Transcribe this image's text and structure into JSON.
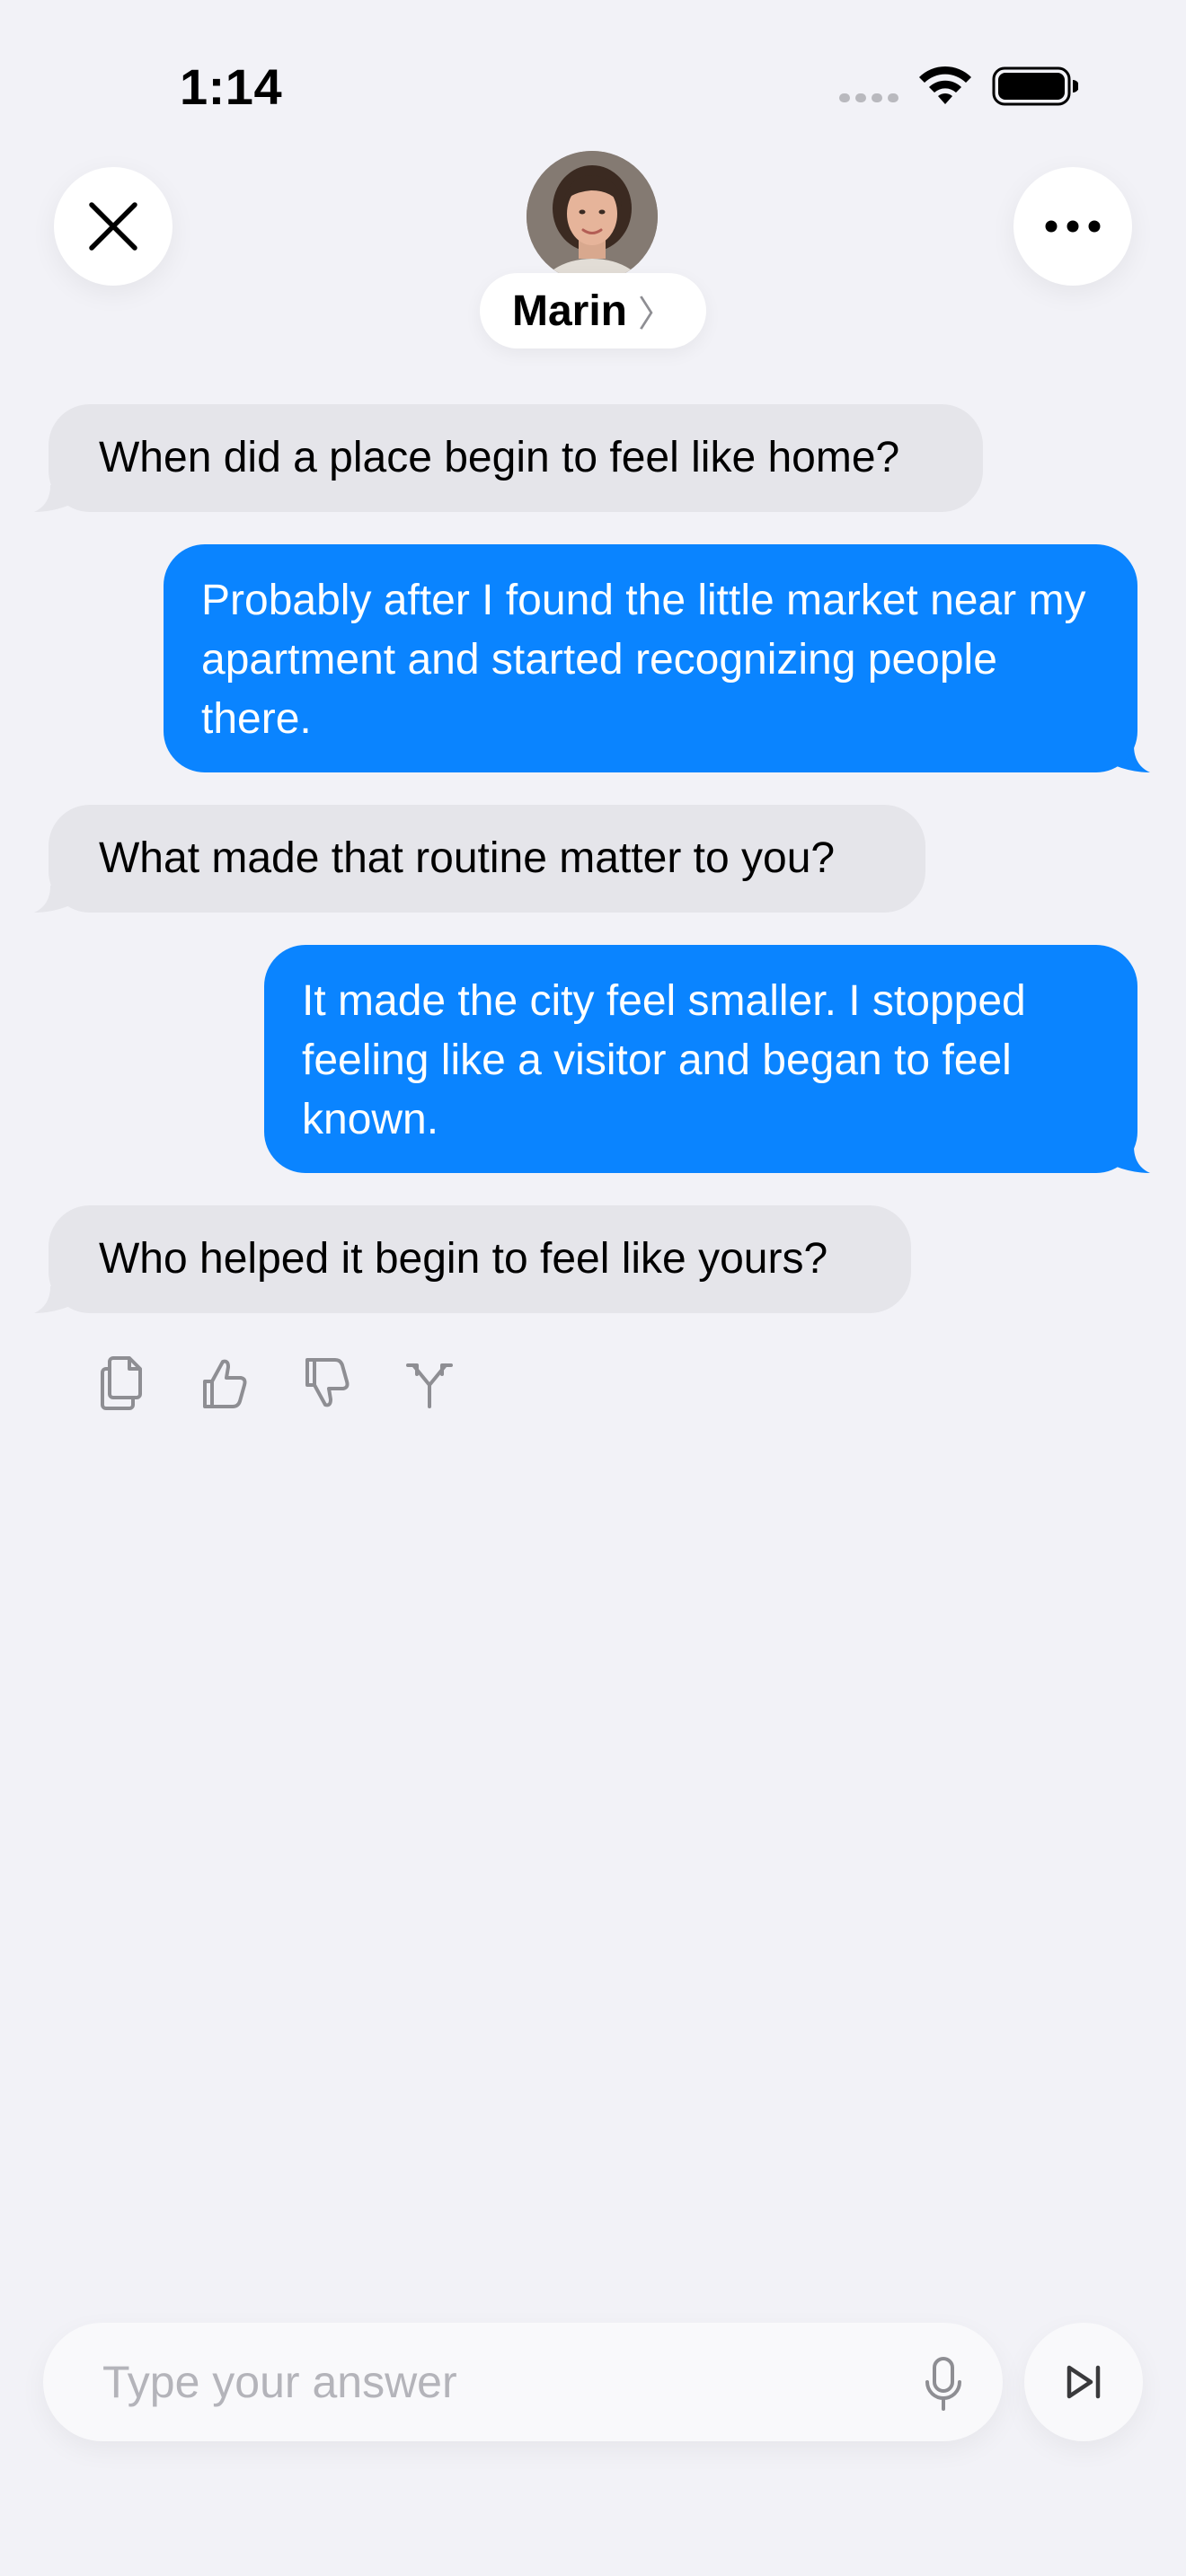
{
  "status_bar": {
    "time": "1:14",
    "icons": [
      "cellular-signal-icon",
      "wifi-icon",
      "battery-icon"
    ]
  },
  "header": {
    "close_icon": "close-icon",
    "more_icon": "more-icon",
    "contact_name": "Marin",
    "chevron": "〉"
  },
  "messages": [
    {
      "sender": "assistant",
      "text": "When did a place begin to feel like home?"
    },
    {
      "sender": "user",
      "text": "Probably after I found the little market near my apartment and started recognizing people there."
    },
    {
      "sender": "assistant",
      "text": "What made that routine matter to you?"
    },
    {
      "sender": "user",
      "text": "It made the city feel smaller. I stopped feeling like a visitor and began to feel known."
    },
    {
      "sender": "assistant",
      "text": "Who helped it begin to feel like yours?"
    }
  ],
  "message_actions": [
    "copy-icon",
    "thumbs-up-icon",
    "thumbs-down-icon",
    "branch-icon"
  ],
  "composer": {
    "placeholder": "Type your answer",
    "value": "",
    "mic_icon": "microphone-icon",
    "skip_icon": "skip-forward-icon"
  },
  "colors": {
    "background": "#f2f2f7",
    "incoming_bubble": "#e5e5ea",
    "outgoing_bubble": "#0a84ff",
    "icon_gray": "#8e8e93"
  }
}
